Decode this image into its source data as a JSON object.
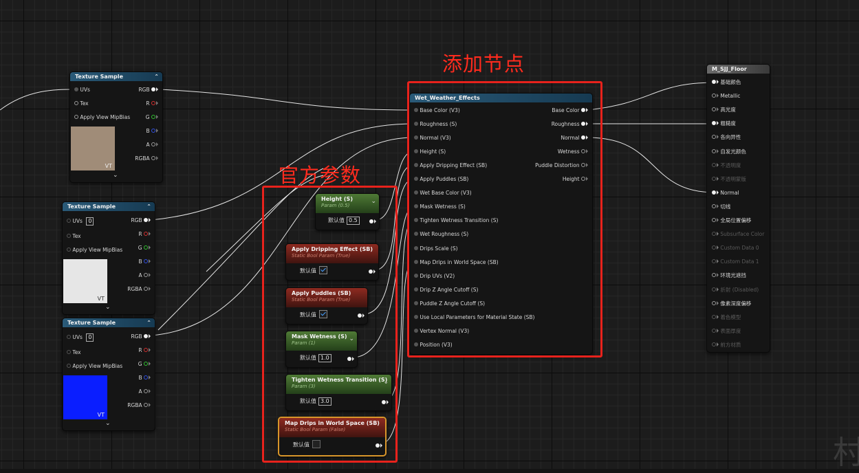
{
  "annotations": {
    "add_node": "添加节点",
    "official_params": "官方参数"
  },
  "texture_sample_1": {
    "title": "Texture Sample",
    "inputs": [
      "UVs",
      "Tex",
      "Apply View MipBias"
    ],
    "outputs": [
      "RGB",
      "R",
      "G",
      "B",
      "A",
      "RGBA"
    ],
    "swatch_color": "#a08c78",
    "vt": "VT"
  },
  "texture_sample_2": {
    "title": "Texture Sample",
    "inputs": [
      "UVs",
      "Tex",
      "Apply View MipBias"
    ],
    "uv_value": "0",
    "outputs": [
      "RGB",
      "R",
      "G",
      "B",
      "A",
      "RGBA"
    ],
    "swatch_color": "#e6e6e6",
    "vt": "VT"
  },
  "texture_sample_3": {
    "title": "Texture Sample",
    "inputs": [
      "UVs",
      "Tex",
      "Apply View MipBias"
    ],
    "uv_value": "0",
    "outputs": [
      "RGB",
      "R",
      "G",
      "B",
      "A",
      "RGBA"
    ],
    "swatch_color": "#0a1eff",
    "vt": "VT"
  },
  "params": {
    "height": {
      "title": "Height (S)",
      "subtitle": "Param (0.5)",
      "label": "默认值",
      "value": "0.5"
    },
    "apply_dripping": {
      "title": "Apply Dripping Effect (SB)",
      "subtitle": "Static Bool Param (True)",
      "label": "默认值",
      "checked": true
    },
    "apply_puddles": {
      "title": "Apply Puddles (SB)",
      "subtitle": "Static Bool Param (True)",
      "label": "默认值",
      "checked": true
    },
    "mask_wetness": {
      "title": "Mask Wetness (S)",
      "subtitle": "Param (1)",
      "label": "默认值",
      "value": "1.0"
    },
    "tighten_wetness": {
      "title": "Tighten Wetness Transition (S)",
      "subtitle": "Param (3)",
      "label": "默认值",
      "value": "3.0"
    },
    "map_drips": {
      "title": "Map Drips in World Space (SB)",
      "subtitle": "Static Bool Param (False)",
      "label": "默认值",
      "checked": false
    }
  },
  "wet_weather": {
    "title": "Wet_Weather_Effects",
    "inputs": [
      "Base Color (V3)",
      "Roughness (S)",
      "Normal (V3)",
      "Height (S)",
      "Apply Dripping Effect (SB)",
      "Apply Puddles (SB)",
      "Wet Base Color (V3)",
      "Mask Wetness (S)",
      "Tighten Wetness Transition (S)",
      "Wet Roughness (S)",
      "Drips Scale (S)",
      "Map Drips in World Space (SB)",
      "Drip UVs (V2)",
      "Drip Z Angle Cutoff (S)",
      "Puddle Z Angle Cutoff (S)",
      "Use Local Parameters for Material State (SB)",
      "Vertex Normal (V3)",
      "Position (V3)"
    ],
    "outputs": [
      "Base Color",
      "Roughness",
      "Normal",
      "Wetness",
      "Puddle Distortion",
      "Height"
    ]
  },
  "material": {
    "title": "M_SJJ_Floor",
    "pins": [
      "基础颜色",
      "Metallic",
      "高光度",
      "粗糙度",
      "各向异性",
      "自发光颜色",
      "不透明度",
      "不透明蒙版",
      "Normal",
      "切线",
      "全局位置偏移",
      "Subsurface Color",
      "Custom Data 0",
      "Custom Data 1",
      "环境光遮挡",
      "折射 (Disabled)",
      "像素深度偏移",
      "着色模型",
      "表面厚度",
      "前方材质"
    ]
  },
  "watermark": "村"
}
